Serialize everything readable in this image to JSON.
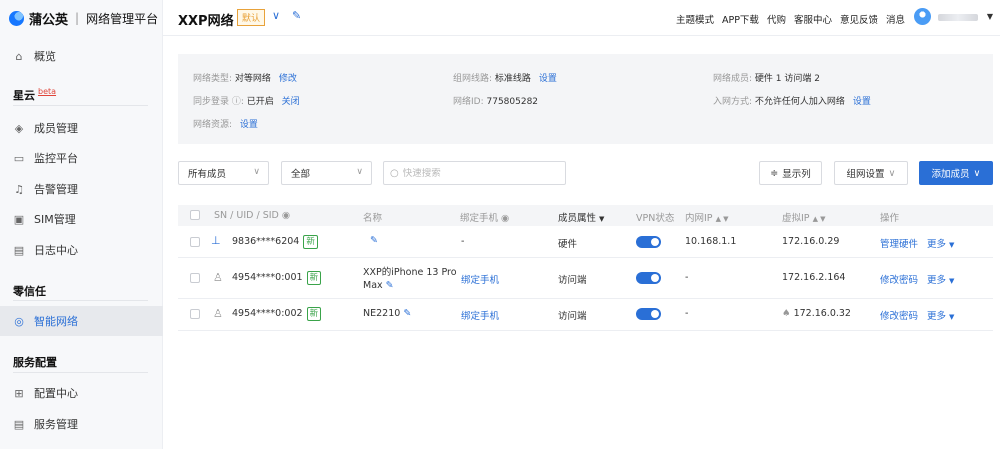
{
  "sidebar": {
    "brand": {
      "name": "蒲公英",
      "subtitle": "网络管理平台"
    },
    "overview": "概览",
    "groups": [
      {
        "title": "星云",
        "tag": "beta",
        "items": [
          "成员管理",
          "监控平台",
          "告警管理",
          "SIM管理",
          "日志中心"
        ]
      },
      {
        "title": "零信任",
        "items": [
          "智能网络"
        ]
      },
      {
        "title": "服务配置",
        "items": [
          "配置中心",
          "服务管理"
        ]
      }
    ]
  },
  "header": {
    "network_name": "XXP网络",
    "default_badge": "默认",
    "links": [
      "主题模式",
      "APP下载",
      "代购",
      "客服中心",
      "意见反馈",
      "消息"
    ]
  },
  "info": {
    "network_type_label": "网络类型:",
    "network_type_value": "对等网络",
    "network_type_link": "修改",
    "route_label": "组网线路:",
    "route_value": "标准线路",
    "route_link": "设置",
    "members_label": "网络成员:",
    "members_value": "硬件 1   访问端 2",
    "sync_label": "同步登录 ⓘ:",
    "sync_value": "已开启",
    "sync_link": "关闭",
    "network_id_label": "网络ID:",
    "network_id_value": "775805282",
    "join_label": "入网方式:",
    "join_value": "不允许任何人加入网络",
    "join_link": "设置",
    "resource_label": "网络资源:",
    "resource_link": "设置"
  },
  "toolbar": {
    "members_filter": "所有成员",
    "status_filter": "全部",
    "search_placeholder": "快速搜索",
    "show_columns": "显示列",
    "network_settings": "组网设置",
    "add_member": "添加成员"
  },
  "table": {
    "columns": [
      "SN / UID / SID",
      "名称",
      "绑定手机",
      "成员属性",
      "VPN状态",
      "内网IP",
      "虚拟IP",
      "操作"
    ],
    "rows": [
      {
        "id": "9836****6204",
        "badge": "新",
        "name": "",
        "phone": "-",
        "attr": "硬件",
        "vpn": true,
        "lan_ip": "10.168.1.1",
        "vip": "172.16.0.29",
        "action": "管理硬件",
        "more": "更多"
      },
      {
        "id": "4954****0:001",
        "badge": "新",
        "name_line1": "XXP的iPhone 13 Pro",
        "name_line2": "Max",
        "phone": "绑定手机",
        "attr": "访问端",
        "vpn": true,
        "lan_ip": "-",
        "vip": "172.16.2.164",
        "action": "修改密码",
        "more": "更多"
      },
      {
        "id": "4954****0:002",
        "badge": "新",
        "name": "NE2210",
        "phone": "绑定手机",
        "attr": "访问端",
        "vpn": true,
        "lan_ip": "-",
        "vip": "172.16.0.32",
        "action": "修改密码",
        "more": "更多"
      }
    ]
  }
}
